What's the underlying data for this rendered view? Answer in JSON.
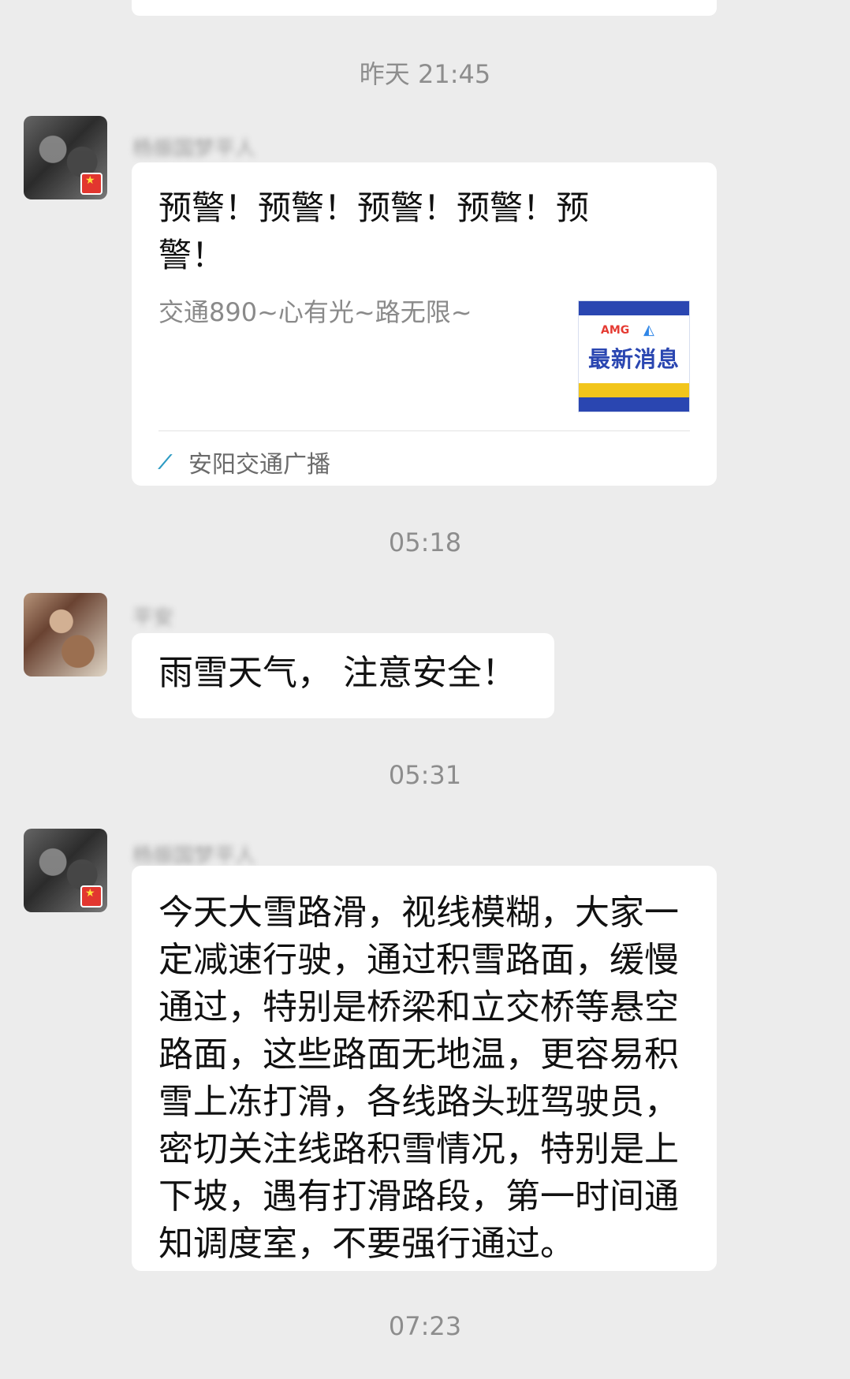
{
  "timestamps": {
    "t1": "昨天 21:45",
    "t2": "05:18",
    "t3": "05:31",
    "t4": "07:23"
  },
  "messages": [
    {
      "sender": "杨振国梦平人",
      "share": {
        "title": "预警！预警！预警！预警！预警！",
        "description": "交通890~心有光~路无限~",
        "source": "安阳交通广播",
        "thumbnail": {
          "logo_left": "AMG",
          "title": "最新消息"
        }
      }
    },
    {
      "sender": "平安",
      "text": "雨雪天气， 注意安全！"
    },
    {
      "sender": "杨振国梦平人",
      "text": "今天大雪路滑，视线模糊，大家一定减速行驶，通过积雪路面，缓慢通过，特别是桥梁和立交桥等悬空路面，这些路面无地温，更容易积雪上冻打滑，各线路头班驾驶员，密切关注线路积雪情况，特别是上下坡，遇有打滑路段，第一时间通知调度室，不要强行通过。"
    }
  ]
}
